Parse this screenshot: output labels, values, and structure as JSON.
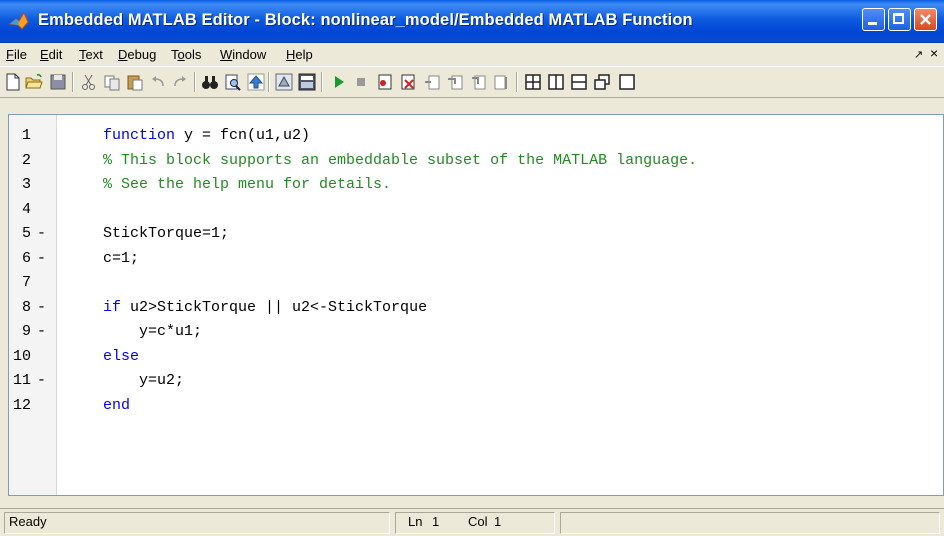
{
  "window": {
    "title": "Embedded MATLAB Editor - Block: nonlinear_model/Embedded MATLAB Function"
  },
  "menu": {
    "items": [
      {
        "label": "File",
        "mnemonic": "F",
        "rest": "ile"
      },
      {
        "label": "Edit",
        "mnemonic": "E",
        "rest": "dit"
      },
      {
        "label": "Text",
        "mnemonic": "T",
        "rest": "ext"
      },
      {
        "label": "Debug",
        "mnemonic": "D",
        "rest": "ebug"
      },
      {
        "label": "Tools",
        "pre": "T",
        "mnemonic": "o",
        "rest": "ols"
      },
      {
        "label": "Window",
        "mnemonic": "W",
        "rest": "indow"
      },
      {
        "label": "Help",
        "mnemonic": "H",
        "rest": "elp"
      }
    ],
    "restore_glyph": "↗",
    "close_glyph": "×"
  },
  "toolbar": {
    "icons": [
      "new-file-icon",
      "open-folder-icon",
      "save-icon",
      "cut-icon",
      "copy-icon",
      "paste-icon",
      "undo-icon",
      "redo-icon",
      "find-icon",
      "find-files-icon",
      "go-up-icon",
      "model-explorer-icon",
      "ports-data-icon",
      "run-icon",
      "stop-icon",
      "set-breakpoint-icon",
      "clear-breakpoints-icon",
      "step-icon",
      "step-in-icon",
      "step-out-icon",
      "exit-debug-icon",
      "tile-grid-icon",
      "tile-vertical-icon",
      "tile-horizontal-icon",
      "float-window-icon",
      "dock-window-icon"
    ]
  },
  "code": {
    "lines": [
      {
        "num": "1",
        "dash": "",
        "parts": [
          {
            "t": "function",
            "c": "kw"
          },
          {
            "t": " y = fcn(u1,u2)",
            "c": "tx"
          }
        ]
      },
      {
        "num": "2",
        "dash": "",
        "parts": [
          {
            "t": "% This block supports an embeddable subset of the MATLAB language.",
            "c": "cm"
          }
        ]
      },
      {
        "num": "3",
        "dash": "",
        "parts": [
          {
            "t": "% See the help menu for details.",
            "c": "cm"
          }
        ]
      },
      {
        "num": "4",
        "dash": "",
        "parts": []
      },
      {
        "num": "5",
        "dash": "-",
        "parts": [
          {
            "t": "StickTorque=1;",
            "c": "tx"
          }
        ]
      },
      {
        "num": "6",
        "dash": "-",
        "parts": [
          {
            "t": "c=1;",
            "c": "tx"
          }
        ]
      },
      {
        "num": "7",
        "dash": "",
        "parts": []
      },
      {
        "num": "8",
        "dash": "-",
        "parts": [
          {
            "t": "if",
            "c": "kw"
          },
          {
            "t": " u2>StickTorque || u2<-StickTorque",
            "c": "tx"
          }
        ]
      },
      {
        "num": "9",
        "dash": "-",
        "parts": [
          {
            "t": "    y=c*u1;",
            "c": "tx"
          }
        ]
      },
      {
        "num": "10",
        "dash": "",
        "parts": [
          {
            "t": "else",
            "c": "kw"
          }
        ]
      },
      {
        "num": "11",
        "dash": "-",
        "parts": [
          {
            "t": "    y=u2;",
            "c": "tx"
          }
        ]
      },
      {
        "num": "12",
        "dash": "",
        "parts": [
          {
            "t": "end",
            "c": "kw"
          }
        ]
      }
    ]
  },
  "status": {
    "state": "Ready",
    "ln_label": "Ln",
    "ln_value": "1",
    "col_label": "Col",
    "col_value": "1"
  },
  "colors": {
    "keyword": "#0000ff",
    "comment": "#228b22",
    "titlebar": "#0a4ccf"
  }
}
